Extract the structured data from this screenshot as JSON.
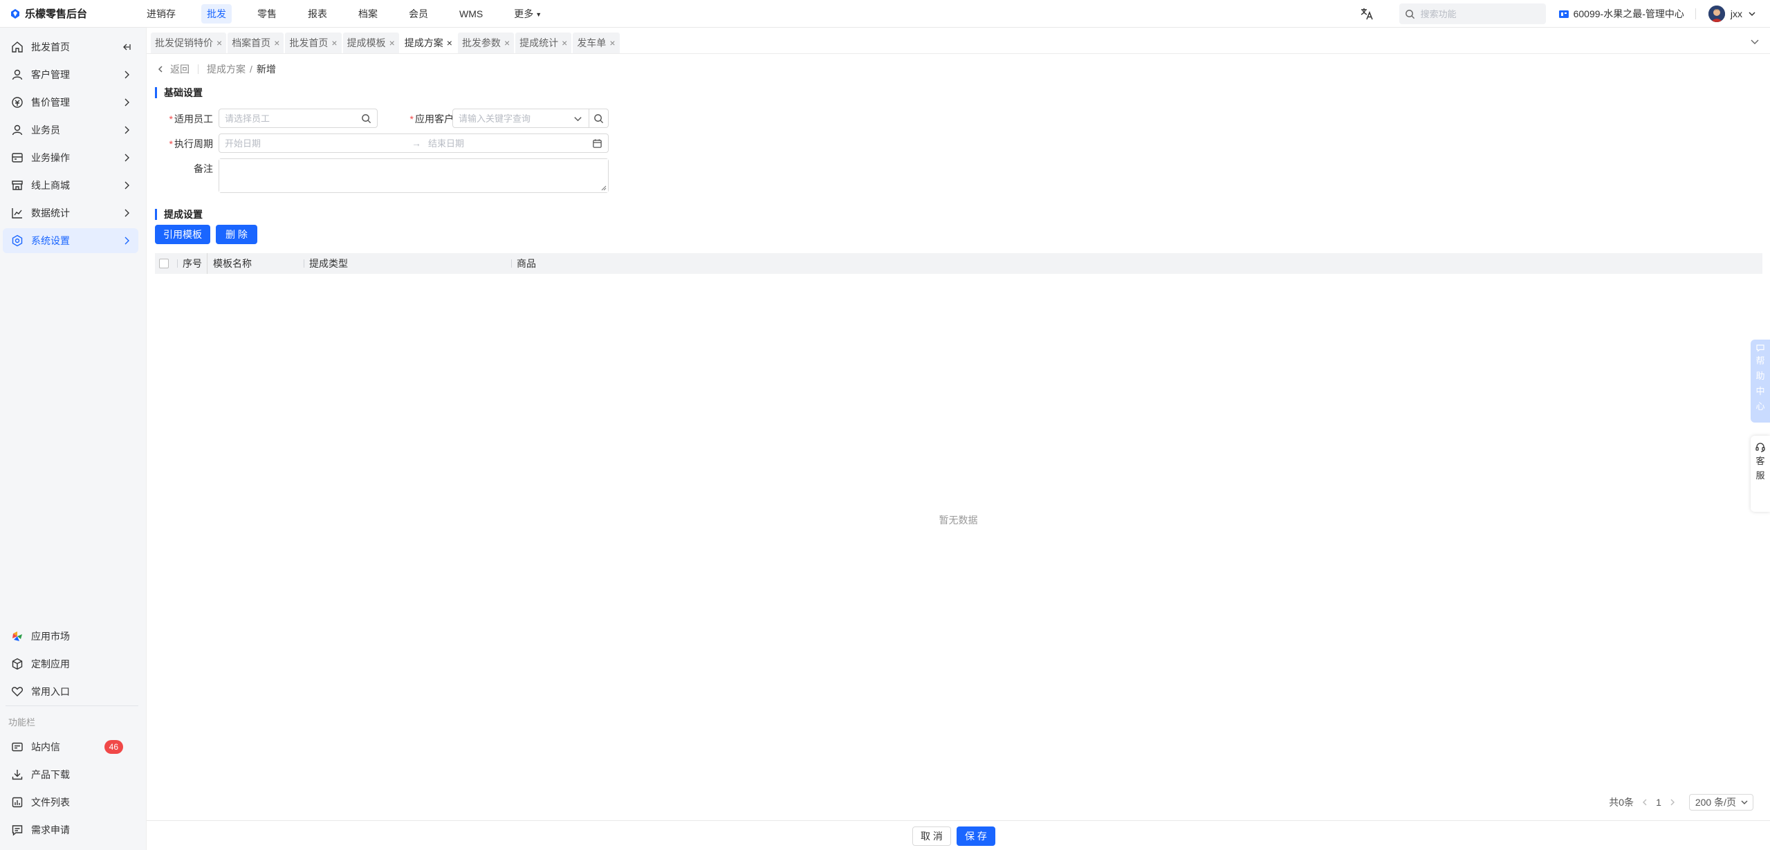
{
  "app": {
    "title": "乐檬零售后台"
  },
  "topnav": {
    "items": [
      "进销存",
      "批发",
      "零售",
      "报表",
      "档案",
      "会员",
      "WMS",
      "更多"
    ],
    "active_index": 1
  },
  "header": {
    "search_placeholder": "搜索功能",
    "store": "60099-水果之最-管理中心",
    "user": "jxx"
  },
  "sidebar": {
    "items": [
      {
        "label": "批发首页",
        "icon": "home-icon"
      },
      {
        "label": "客户管理",
        "icon": "user-icon"
      },
      {
        "label": "售价管理",
        "icon": "price-icon"
      },
      {
        "label": "业务员",
        "icon": "salesman-icon"
      },
      {
        "label": "业务操作",
        "icon": "operation-icon"
      },
      {
        "label": "线上商城",
        "icon": "store-icon"
      },
      {
        "label": "数据统计",
        "icon": "chart-icon"
      },
      {
        "label": "系统设置",
        "icon": "settings-icon"
      }
    ],
    "active_index": 7,
    "bottom": [
      {
        "label": "应用市场"
      },
      {
        "label": "定制应用"
      },
      {
        "label": "常用入口"
      }
    ],
    "section_label": "功能栏",
    "tools": [
      {
        "label": "站内信",
        "badge": "46"
      },
      {
        "label": "产品下载"
      },
      {
        "label": "文件列表"
      },
      {
        "label": "需求申请"
      }
    ]
  },
  "tabs": {
    "items": [
      "批发促销特价",
      "档案首页",
      "批发首页",
      "提成模板",
      "提成方案",
      "批发参数",
      "提成统计",
      "发车单"
    ],
    "active_index": 4
  },
  "breadcrumb": {
    "back": "返回",
    "parent": "提成方案",
    "current": "新增"
  },
  "basic": {
    "title": "基础设置",
    "employee_label": "适用员工",
    "employee_placeholder": "请选择员工",
    "customer_label": "应用客户",
    "customer_placeholder": "请输入关键字查询",
    "period_label": "执行周期",
    "start_placeholder": "开始日期",
    "end_placeholder": "结束日期",
    "remark_label": "备注"
  },
  "commission": {
    "title": "提成设置",
    "use_template": "引用模板",
    "delete": "删 除",
    "columns": [
      "序号",
      "模板名称",
      "提成类型",
      "商品"
    ],
    "empty": "暂无数据"
  },
  "pager": {
    "total": "共0条",
    "page": "1",
    "size": "200 条/页"
  },
  "footer": {
    "cancel": "取 消",
    "save": "保 存"
  },
  "float": {
    "help": [
      "帮",
      "助",
      "中",
      "心"
    ],
    "service": [
      "客",
      "服"
    ]
  },
  "colors": {
    "primary": "#1a66ff",
    "badge": "#f04848"
  }
}
